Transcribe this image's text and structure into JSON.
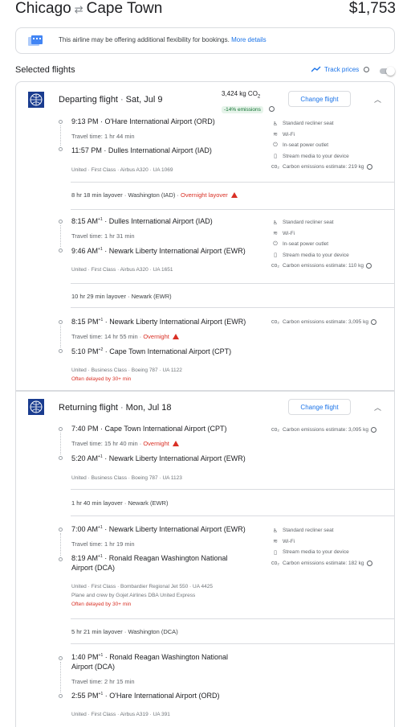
{
  "header": {
    "origin": "Chicago",
    "destination": "Cape Town",
    "price": "$1,753"
  },
  "notice": {
    "text": "This airline may be offering additional flexibility for bookings.",
    "link": "More details"
  },
  "selected_title": "Selected flights",
  "track_prices": "Track prices",
  "departing": {
    "label": "Departing flight",
    "date": "Sat, Jul 9",
    "co2": "3,424 kg CO",
    "co2_sub": "2",
    "co2_badge": "-14% emissions",
    "change": "Change flight",
    "seg1": {
      "dep_time": "9:13 PM",
      "dep_airport": "O'Hare International Airport (ORD)",
      "travel": "Travel time: 1 hr 44 min",
      "arr_time": "11:57 PM",
      "arr_airport": "Dulles International Airport (IAD)",
      "details": "United · First Class · Airbus A320 · UA 1069",
      "amen": [
        "Standard recliner seat",
        "Wi-Fi",
        "In-seat power outlet",
        "Stream media to your device",
        "Carbon emissions estimate: 219 kg"
      ]
    },
    "layover1": {
      "text": "8 hr 18 min layover · Washington (IAD) · ",
      "warn": "Overnight layover"
    },
    "seg2": {
      "dep_time": "8:15 AM",
      "dep_sup": "+1",
      "dep_airport": "Dulles International Airport (IAD)",
      "travel": "Travel time: 1 hr 31 min",
      "arr_time": "9:46 AM",
      "arr_sup": "+1",
      "arr_airport": "Newark Liberty International Airport (EWR)",
      "details": "United · First Class · Airbus A320 · UA 1651",
      "amen": [
        "Standard recliner seat",
        "Wi-Fi",
        "In-seat power outlet",
        "Stream media to your device",
        "Carbon emissions estimate: 110 kg"
      ]
    },
    "layover2": {
      "text": "10 hr 29 min layover · Newark (EWR)"
    },
    "seg3": {
      "dep_time": "8:15 PM",
      "dep_sup": "+1",
      "dep_airport": "Newark Liberty International Airport (EWR)",
      "travel": "Travel time: 14 hr 55 min · ",
      "travel_warn": "Overnight",
      "arr_time": "5:10 PM",
      "arr_sup": "+2",
      "arr_airport": "Cape Town International Airport (CPT)",
      "details": "United · Business Class · Boeing 787 · UA 1122",
      "delay": "Often delayed by 30+ min",
      "amen": [
        "Carbon emissions estimate: 3,095 kg"
      ]
    }
  },
  "returning": {
    "label": "Returning flight",
    "date": "Mon, Jul 18",
    "change": "Change flight",
    "seg1": {
      "dep_time": "7:40 PM",
      "dep_airport": "Cape Town International Airport (CPT)",
      "travel": "Travel time: 15 hr 40 min · ",
      "travel_warn": "Overnight",
      "arr_time": "5:20 AM",
      "arr_sup": "+1",
      "arr_airport": "Newark Liberty International Airport (EWR)",
      "details": "United · Business Class · Boeing 787 · UA 1123",
      "amen": [
        "Carbon emissions estimate: 3,095 kg"
      ]
    },
    "layover1": {
      "text": "1 hr 40 min layover · Newark (EWR)"
    },
    "seg2": {
      "dep_time": "7:00 AM",
      "dep_sup": "+1",
      "dep_airport": "Newark Liberty International Airport (EWR)",
      "travel": "Travel time: 1 hr 19 min",
      "arr_time": "8:19 AM",
      "arr_sup": "+1",
      "arr_airport_l1": "Ronald Reagan Washington National",
      "arr_airport_l2": "Airport (DCA)",
      "details": "United · First Class · Bombardier Regional Jet 550 · UA 4425",
      "operator": "Plane and crew by Gojet Airlines DBA United Express",
      "delay": "Often delayed by 30+ min",
      "amen": [
        "Standard recliner seat",
        "Wi-Fi",
        "Stream media to your device",
        "Carbon emissions estimate: 182 kg"
      ]
    },
    "layover2": {
      "text": "5 hr 21 min layover · Washington (DCA)"
    },
    "seg3": {
      "dep_time": "1:40 PM",
      "dep_sup": "+1",
      "dep_airport_l1": "Ronald Reagan Washington National",
      "dep_airport_l2": "Airport (DCA)",
      "travel": "Travel time: 2 hr 15 min",
      "arr_time": "2:55 PM",
      "arr_sup": "+1",
      "arr_airport": "O'Hare International Airport (ORD)",
      "details": "United · First Class · Airbus A319 · UA 391"
    }
  }
}
